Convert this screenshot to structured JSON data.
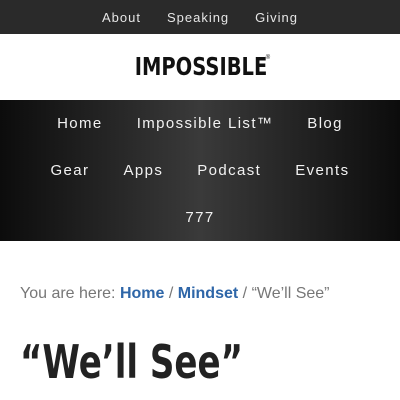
{
  "top_nav": {
    "items": [
      "About",
      "Speaking",
      "Giving"
    ]
  },
  "logo": {
    "text": "IMPOSSIBLE",
    "mark": "®"
  },
  "main_nav": {
    "items": [
      "Home",
      "Impossible List™",
      "Blog",
      "Gear",
      "Apps",
      "Podcast",
      "Events",
      "777"
    ]
  },
  "breadcrumb": {
    "prefix": "You are here:",
    "home": "Home",
    "separator": "/",
    "category": "Mindset",
    "current": "“We’ll See”"
  },
  "page": {
    "title": "“We’ll See”"
  },
  "colors": {
    "topbar": "#2a2a2a",
    "nav_background": "#1a1a1a",
    "link": "#2e66a8"
  }
}
